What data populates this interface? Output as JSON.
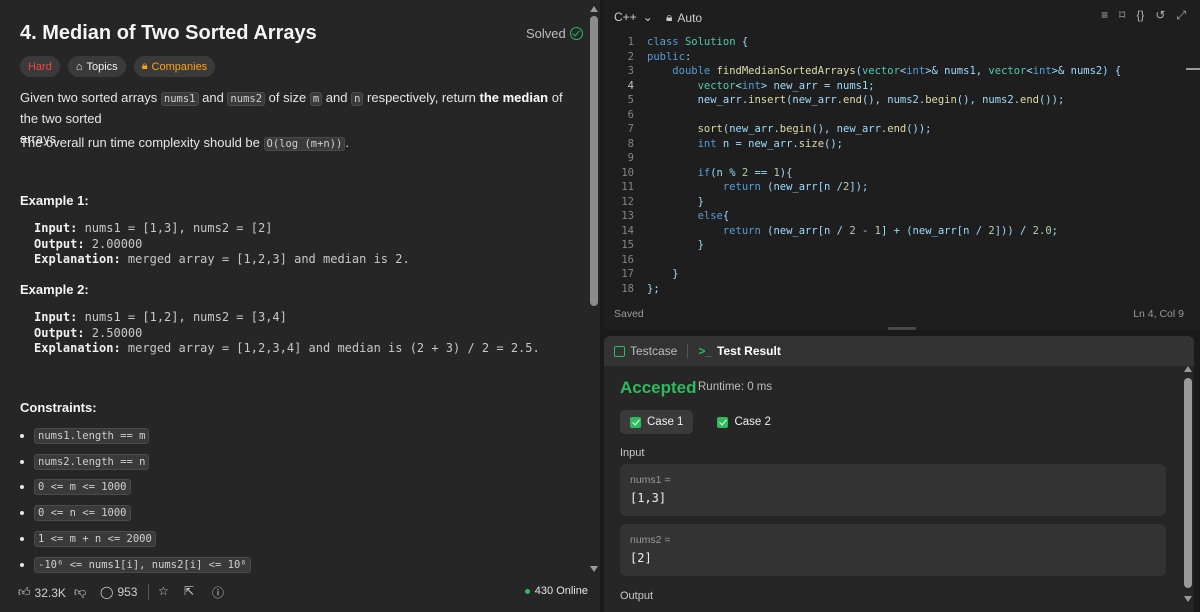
{
  "problem": {
    "title": "4. Median of Two Sorted Arrays",
    "status": "Solved",
    "tags": {
      "difficulty": "Hard",
      "topics": "Topics",
      "companies": "Companies"
    },
    "desc1": {
      "a": "Given two sorted arrays ",
      "c1": "nums1",
      "b": " and ",
      "c2": "nums2",
      "c": " of size ",
      "c3": "m",
      "d": " and ",
      "c4": "n",
      "e": " respectively, return ",
      "bold": "the median",
      "f": " of the two sorted",
      "g": "arrays."
    },
    "desc2": {
      "a": "The overall run time complexity should be ",
      "c": "O(log (m+n))",
      "b": "."
    },
    "example1": {
      "title": "Example 1:",
      "input_label": "Input:",
      "input": " nums1 = [1,3], nums2 = [2]",
      "output_label": "Output:",
      "output": " 2.00000",
      "expl_label": "Explanation:",
      "expl": " merged array = [1,2,3] and median is 2."
    },
    "example2": {
      "title": "Example 2:",
      "input_label": "Input:",
      "input": " nums1 = [1,2], nums2 = [3,4]",
      "output_label": "Output:",
      "output": " 2.50000",
      "expl_label": "Explanation:",
      "expl": " merged array = [1,2,3,4] and median is (2 + 3) / 2 = 2.5."
    },
    "constraints_title": "Constraints:",
    "constraints": [
      "nums1.length == m",
      "nums2.length == n",
      "0 <= m <= 1000",
      "0 <= n <= 1000",
      "1 <= m + n <= 2000",
      "-10⁶ <= nums1[i], nums2[i] <= 10⁶"
    ],
    "footer": {
      "likes": "32.3K",
      "comments": "953",
      "online": "430 Online"
    }
  },
  "editor": {
    "language": "C++",
    "mode": "Auto",
    "lines": [
      "class Solution {",
      "public:",
      "    double findMedianSortedArrays(vector<int>& nums1, vector<int>& nums2) {",
      "        vector<int> new_arr = nums1;",
      "        new_arr.insert(new_arr.end(), nums2.begin(), nums2.end());",
      "",
      "        sort(new_arr.begin(), new_arr.end());",
      "        int n = new_arr.size();",
      "",
      "        if(n % 2 == 1){",
      "            return (new_arr[n /2]);",
      "        }",
      "        else{",
      "            return (new_arr[n / 2 - 1] + (new_arr[n / 2])) / 2.0;",
      "        }",
      "",
      "    }",
      "};"
    ],
    "saved": "Saved",
    "cursor": "Ln 4, Col 9"
  },
  "result": {
    "tab_testcase": "Testcase",
    "tab_result": "Test Result",
    "verdict": "Accepted",
    "runtime": "Runtime: 0 ms",
    "cases": [
      "Case 1",
      "Case 2"
    ],
    "input_label": "Input",
    "vars": [
      {
        "name": "nums1 =",
        "value": "[1,3]"
      },
      {
        "name": "nums2 =",
        "value": "[2]"
      }
    ],
    "output_label": "Output"
  },
  "colors": {
    "accent_green": "#2cbb5d",
    "hard_red": "#ef4743",
    "companies_orange": "#ffa116"
  }
}
